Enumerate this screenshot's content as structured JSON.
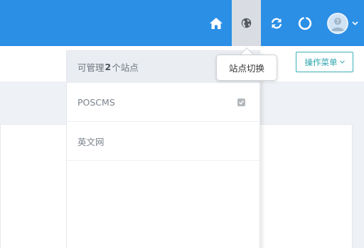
{
  "topbar": {
    "bg_color": "#2b8fe6",
    "icons": [
      "home-icon",
      "globe-icon",
      "refresh-icon",
      "power-icon",
      "avatar",
      "caret-down-icon"
    ]
  },
  "toolbar": {
    "action_menu_label": "操作菜单"
  },
  "site_dropdown": {
    "header_prefix": "可管理",
    "count": "2",
    "header_suffix": "个站点",
    "sites": [
      {
        "name": "POSCMS",
        "checked": true
      },
      {
        "name": "英文网",
        "checked": false
      }
    ]
  },
  "tooltip": {
    "text": "站点切换"
  }
}
